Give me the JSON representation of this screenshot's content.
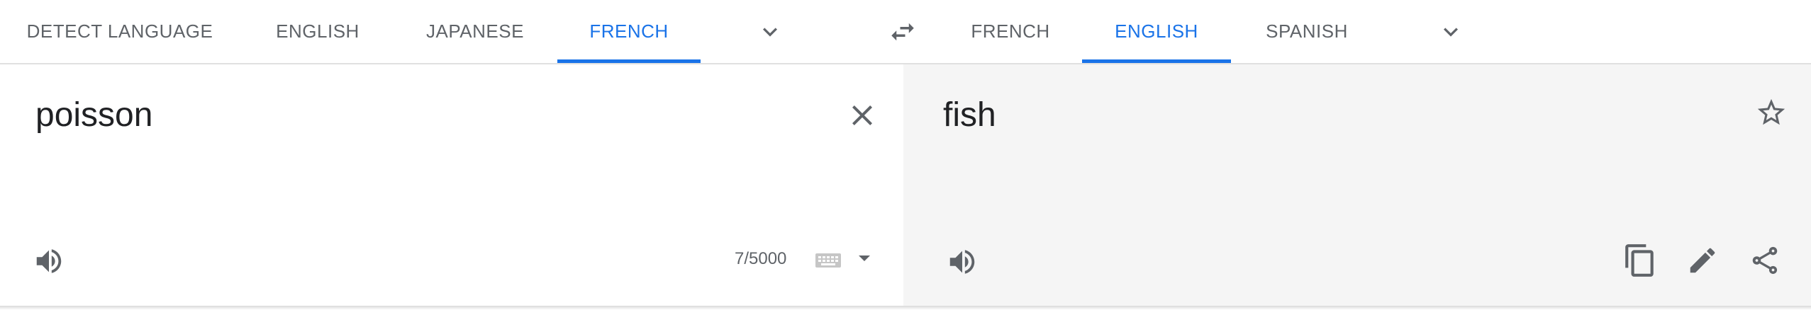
{
  "source_languages": {
    "tabs": [
      "DETECT LANGUAGE",
      "ENGLISH",
      "JAPANESE",
      "FRENCH"
    ],
    "active": "FRENCH"
  },
  "target_languages": {
    "tabs": [
      "FRENCH",
      "ENGLISH",
      "SPANISH"
    ],
    "active": "ENGLISH"
  },
  "source": {
    "text": "poisson",
    "char_count": "7/5000"
  },
  "target": {
    "text": "fish"
  },
  "colors": {
    "accent": "#1a73e8",
    "tab_text": "#5f6368",
    "result_bg": "#f5f5f5"
  },
  "icons": {
    "source_more": "chevron-down-icon",
    "swap": "swap-arrows-icon",
    "target_more": "chevron-down-icon",
    "clear": "close-icon",
    "source_listen": "speaker-icon",
    "keyboard": "keyboard-icon",
    "input_tools": "caret-down-icon",
    "star": "star-outline-icon",
    "target_listen": "speaker-icon",
    "copy": "copy-icon",
    "edit": "pencil-icon",
    "share": "share-icon"
  }
}
